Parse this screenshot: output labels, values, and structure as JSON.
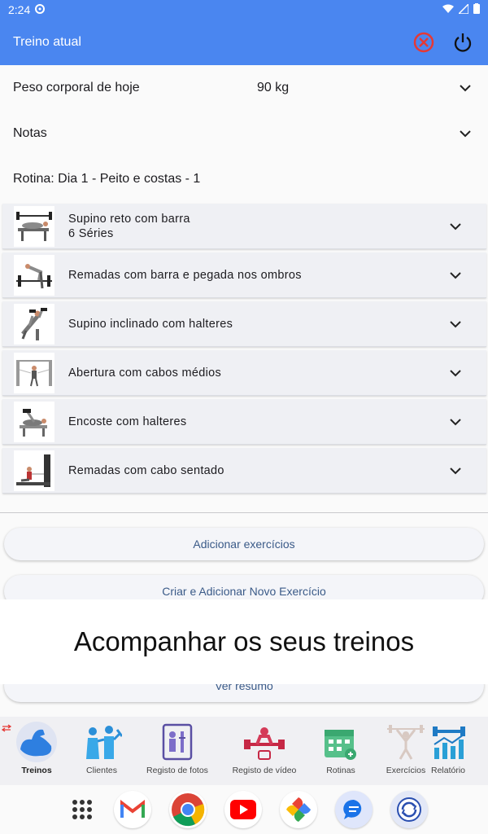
{
  "status_bar": {
    "time": "2:24"
  },
  "app_bar": {
    "title": "Treino atual",
    "icons": [
      "cancel-circle-icon",
      "power-icon"
    ],
    "accent": "#4a86f0"
  },
  "fields": {
    "bodyweight_label": "Peso corporal de hoje",
    "bodyweight_value": "90 kg",
    "notes_label": "Notas",
    "routine_label": "Rotina: Dia 1 - Peito e costas - 1"
  },
  "exercises": [
    {
      "name": "Supino reto com barra",
      "sets": "6 Séries"
    },
    {
      "name": "Remadas com barra e pegada nos ombros"
    },
    {
      "name": "Supino inclinado com halteres"
    },
    {
      "name": "Abertura com cabos médios"
    },
    {
      "name": "Encoste com halteres"
    },
    {
      "name": "Remadas com cabo sentado"
    }
  ],
  "buttons": {
    "add_exercises": "Adicionar exercícios",
    "create_add": "Criar e Adicionar Novo Exercício",
    "view_summary": "Ver resumo"
  },
  "overlay_caption": "Acompanhar os seus treinos",
  "bottom_nav": [
    {
      "label": "Treinos",
      "icon": "muscle-arm-icon",
      "active": true
    },
    {
      "label": "Clientes",
      "icon": "clients-icon"
    },
    {
      "label": "Registo de fotos",
      "icon": "photo-log-icon"
    },
    {
      "label": "Registo de vídeo",
      "icon": "video-log-icon"
    },
    {
      "label": "Rotinas",
      "icon": "calendar-icon"
    },
    {
      "label": "Exercícios",
      "icon": "exercise-figure-icon"
    },
    {
      "label": "Relatório",
      "icon": "report-chart-icon"
    }
  ],
  "dock_apps": [
    "app-drawer-icon",
    "gmail-icon",
    "chrome-icon",
    "youtube-icon",
    "photos-icon",
    "messages-icon",
    "sync-app-icon"
  ]
}
